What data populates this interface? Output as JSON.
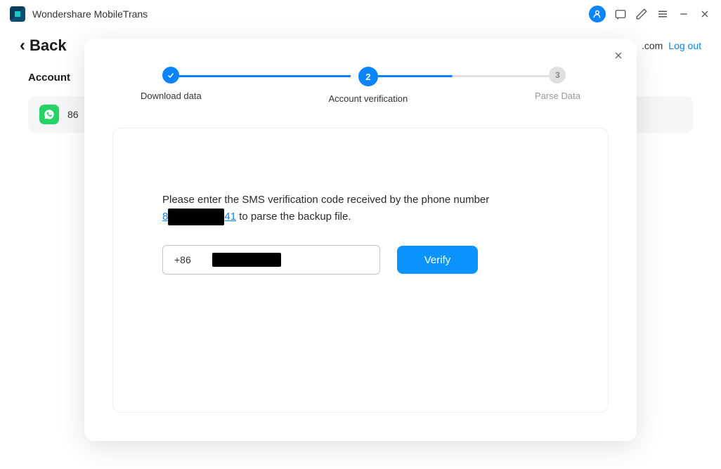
{
  "app": {
    "title": "Wondershare MobileTrans"
  },
  "header": {
    "back": "Back",
    "email_partial": ".com",
    "logout": "Log out"
  },
  "account": {
    "label": "Account",
    "phone_partial": "86"
  },
  "modal": {
    "steps": {
      "s1_label": "Download data",
      "s2_num": "2",
      "s2_label": "Account verification",
      "s3_num": "3",
      "s3_label": "Parse Data"
    },
    "instruction_part1": "Please enter the SMS verification code received by the phone number ",
    "phone_link_prefix": "8",
    "phone_link_suffix": "41",
    "phone_redacted": "XXXXXXXX",
    "instruction_part2": " to parse the backup file.",
    "input_prefix": "+86",
    "input_redacted": "13XXXXXXXX",
    "verify": "Verify"
  }
}
